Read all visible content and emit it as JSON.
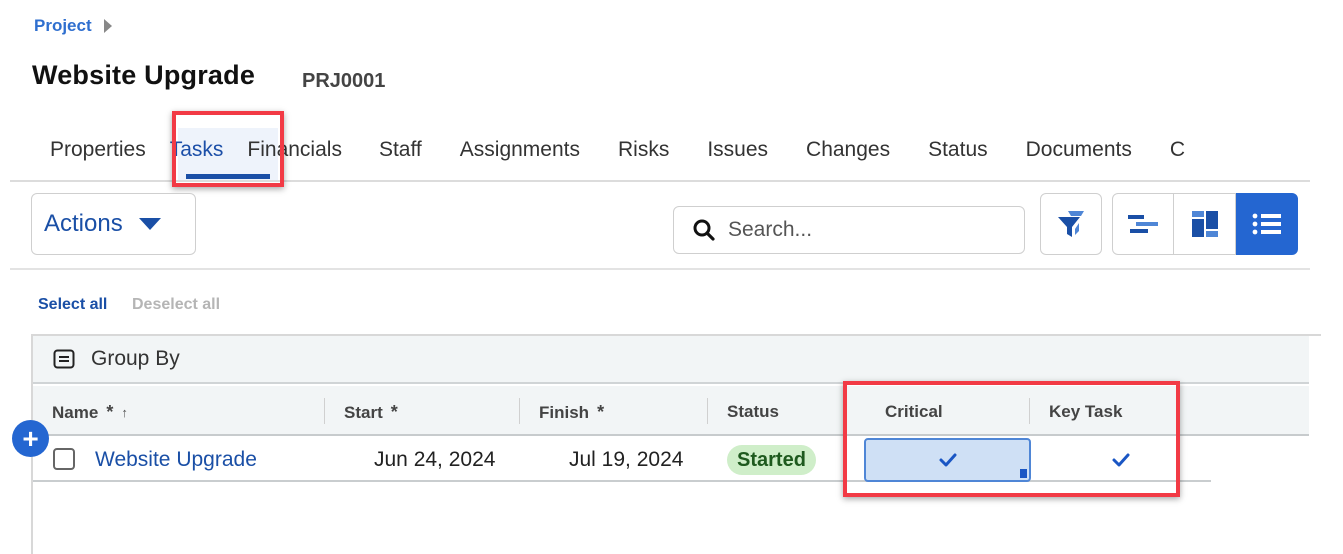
{
  "breadcrumb": {
    "label": "Project"
  },
  "header": {
    "title": "Website Upgrade",
    "project_id": "PRJ0001"
  },
  "tabs": [
    {
      "label": "Properties",
      "active": false
    },
    {
      "label": "Tasks",
      "active": true
    },
    {
      "label": "Financials",
      "active": false
    },
    {
      "label": "Staff",
      "active": false
    },
    {
      "label": "Assignments",
      "active": false
    },
    {
      "label": "Risks",
      "active": false
    },
    {
      "label": "Issues",
      "active": false
    },
    {
      "label": "Changes",
      "active": false
    },
    {
      "label": "Status",
      "active": false
    },
    {
      "label": "Documents",
      "active": false
    },
    {
      "label": "C",
      "active": false
    }
  ],
  "toolbar": {
    "actions_label": "Actions",
    "search_placeholder": "Search...",
    "icons": [
      "filter-icon",
      "gantt-view-icon",
      "board-view-icon",
      "list-view-icon"
    ],
    "active_view": "list"
  },
  "selection": {
    "select_all": "Select all",
    "deselect_all": "Deselect all"
  },
  "grid": {
    "group_by_label": "Group By",
    "columns": [
      {
        "label": "Name",
        "required": true,
        "sorted": "asc"
      },
      {
        "label": "Start",
        "required": true
      },
      {
        "label": "Finish",
        "required": true
      },
      {
        "label": "Status"
      },
      {
        "label": "Critical"
      },
      {
        "label": "Key Task"
      }
    ],
    "rows": [
      {
        "name": "Website Upgrade",
        "start": "Jun 24, 2024",
        "finish": "Jul 19, 2024",
        "status": "Started",
        "critical": true,
        "key_task": true
      }
    ],
    "required_marker": "*",
    "sort_marker": "↑",
    "add_label": "+"
  },
  "colors": {
    "accent": "#2466d1",
    "link": "#1a4fa6",
    "highlight_box": "#f23a45",
    "status_started_bg": "#cfeec9",
    "selected_cell_bg": "#cfe0f5"
  }
}
